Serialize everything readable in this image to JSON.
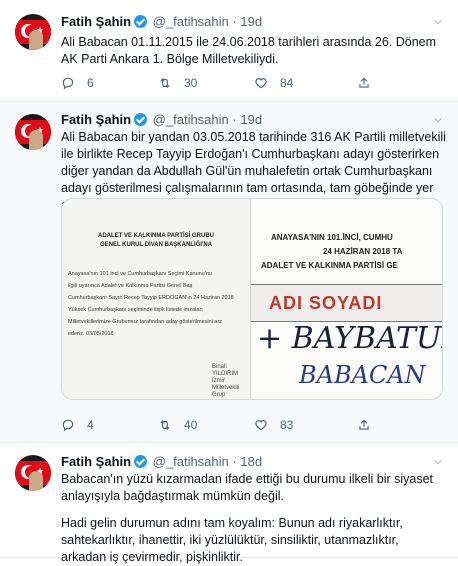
{
  "tweets": [
    {
      "name": "Fatih Şahin",
      "handle": "@_fatihsahin",
      "sep": "·",
      "time": "19d",
      "text": "Ali Babacan 01.11.2015 ile 24.06.2018 tarihleri arasında 26. Dönem AK Parti Ankara 1. Bölge Milletvekiliydi.",
      "replies": "6",
      "retweets": "30",
      "likes": "84"
    },
    {
      "name": "Fatih Şahin",
      "handle": "@_fatihsahin",
      "sep": "·",
      "time": "19d",
      "text": "Ali Babacan bir yandan 03.05.2018 tarihinde 316 AK Partili milletvekili ile birlikte Recep Tayyip Erdoğan'ı Cumhurbaşkanı adayı gösterirken diğer yandan da Abdullah Gül'ün muhalefetin ortak Cumhurbaşkanı adayı gösterilmesi çalışmalarının tam ortasında, tam göbeğinde yer almış.",
      "replies": "4",
      "retweets": "40",
      "likes": "83",
      "media": {
        "doc1": {
          "title1": "ADALET VE KALKINMA PARTİSİ GRUBU",
          "title2": "GENEL KURUL DİVAN BAŞKANLIĞI'NA",
          "lines": [
            "Anayasa'nın 101 inci ve Cumhurbaşkanı Seçimi Kanunu'nu",
            "ilgili uyarınca Adalet ve Kalkınma Partisi Genel Baş",
            "Cumhurbaşkanı Sayın Recep Tayyip ERDOĞAN'ın 24 Haziran 2018",
            "Yüksek Cumhurbaşkanı seçiminde ilişik listede imzaları",
            "Milletvekillerimize Grubumuz tarafından aday gösterilmesini arz",
            "ederiz. 03/05/2018"
          ],
          "signature": "Binali YILDIRIM İzmir Milletvekili Grup Başkanı"
        },
        "doc2": {
          "line1": "ANAYASA'NIN 101.İNCİ, CUMHU",
          "line2": "24 HAZİRAN 2018 TA",
          "line3": "ADALET VE KALKINMA PARTİSİ GE",
          "column_header": "ADI SOYADI",
          "hand1": "+ BAYBATUR",
          "hand2": "BABACAN"
        }
      }
    },
    {
      "name": "Fatih Şahin",
      "handle": "@_fatihsahin",
      "sep": "·",
      "time": "18d",
      "para1": "Babacan'ın yüzü kızarmadan ifade ettiği bu durumu ilkeli bir siyaset anlayışıyla bağdaştırmak mümkün değil.",
      "para2": "Hadi gelin durumun adını tam koyalım: Bunun adı riyakarlıktır, sahtekarlıktır, ihanettir, iki yüzlülüktür, sinsiliktir, utanmazlıktır, arkadan iş çevirmedir, pişkinliktir."
    }
  ],
  "colors": {
    "muted": "#536471",
    "verified": "#1d9bf0",
    "border": "#e6ecf0"
  }
}
